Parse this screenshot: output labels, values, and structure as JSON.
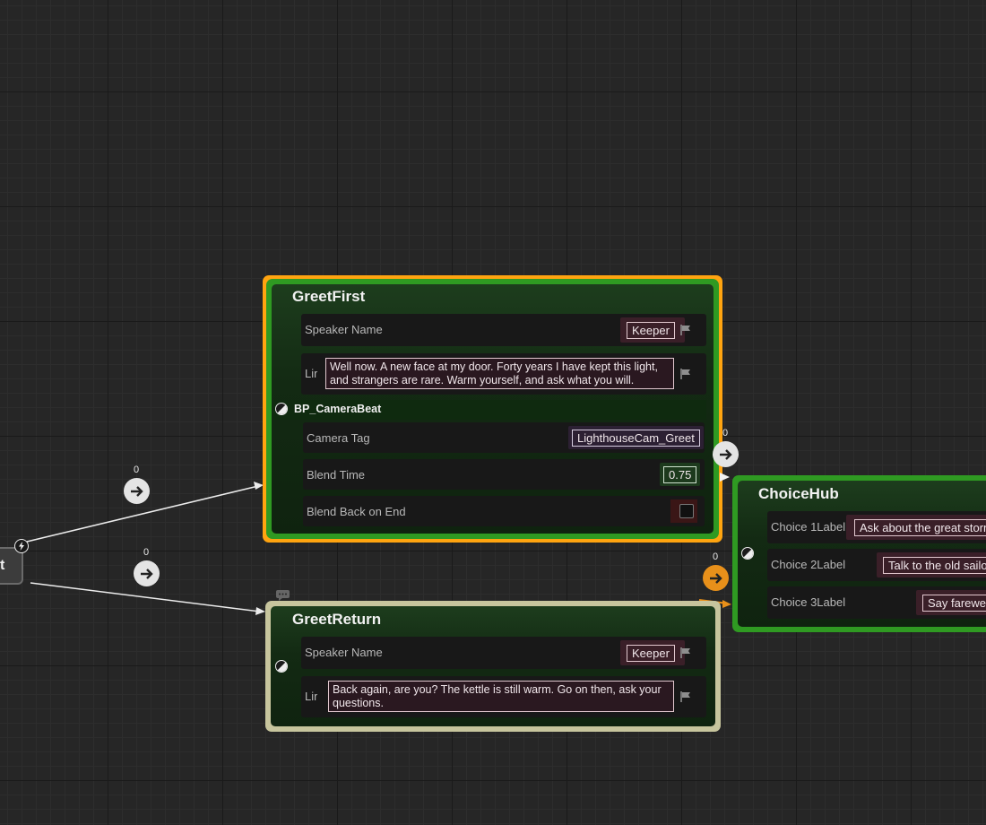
{
  "colors": {
    "node_green": "#2f9a22",
    "selected_orange": "#ffa410",
    "return_frame": "#c7c59d",
    "wire": "#ececec",
    "exec_orange": "#e8901a"
  },
  "start_node": {
    "label": "t"
  },
  "wires": {
    "top_count": "0",
    "bottom_count": "0"
  },
  "greet_first": {
    "title": "GreetFirst",
    "speaker_label": "Speaker Name",
    "speaker_value": "Keeper",
    "line_label": "Lir",
    "line_value": "Well now. A new face at my door. Forty years I have kept this light, and strangers are rare. Warm yourself, and ask what you will.",
    "event_title": "BP_CameraBeat",
    "camera_tag_label": "Camera Tag",
    "camera_tag_value": "LighthouseCam_Greet",
    "blend_time_label": "Blend Time",
    "blend_time_value": "0.75",
    "blend_back_label": "Blend Back on End",
    "out_count": "0"
  },
  "greet_return": {
    "title": "GreetReturn",
    "speaker_label": "Speaker Name",
    "speaker_value": "Keeper",
    "line_label": "Lir",
    "line_value": "Back again, are you? The kettle is still warm. Go on then, ask your questions."
  },
  "choice_hub": {
    "title": "ChoiceHub",
    "in_count": "0",
    "choices": [
      {
        "label": "Choice 1Label",
        "value": "Ask about the great storm"
      },
      {
        "label": "Choice 2Label",
        "value": "Talk to the old sailor"
      },
      {
        "label": "Choice 3Label",
        "value": "Say farewell"
      }
    ]
  },
  "icons": [
    "bolt-icon",
    "arrow-right-icon",
    "flag-icon",
    "half-circle-pin-icon",
    "comment-bubble-icon",
    "exec-triangle-icon"
  ]
}
